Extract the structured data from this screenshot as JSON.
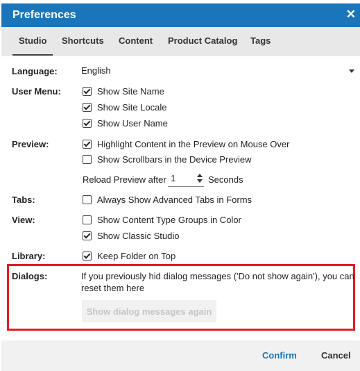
{
  "dialog": {
    "title": "Preferences",
    "close_glyph": "✕"
  },
  "tabs": [
    {
      "label": "Studio",
      "active": true
    },
    {
      "label": "Shortcuts"
    },
    {
      "label": "Content"
    },
    {
      "label": "Product Catalog"
    },
    {
      "label": "Tags"
    }
  ],
  "language": {
    "label": "Language:",
    "value": "English"
  },
  "user_menu": {
    "label": "User Menu:",
    "options": [
      {
        "label": "Show Site Name",
        "checked": true
      },
      {
        "label": "Show Site Locale",
        "checked": true
      },
      {
        "label": "Show User Name",
        "checked": true
      }
    ]
  },
  "preview": {
    "label": "Preview:",
    "options": [
      {
        "label": "Highlight Content in the Preview on Mouse Over",
        "checked": true
      },
      {
        "label": "Show Scrollbars in the Device Preview",
        "checked": false
      }
    ],
    "reload_prefix": "Reload Preview after",
    "reload_value": "1",
    "reload_suffix": "Seconds"
  },
  "tabs_pref": {
    "label": "Tabs:",
    "options": [
      {
        "label": "Always Show Advanced Tabs in Forms",
        "checked": false
      }
    ]
  },
  "view": {
    "label": "View:",
    "options": [
      {
        "label": "Show Content Type Groups in Color",
        "checked": false
      },
      {
        "label": "Show Classic Studio",
        "checked": true
      }
    ]
  },
  "library": {
    "label": "Library:",
    "options": [
      {
        "label": "Keep Folder on Top",
        "checked": true
      }
    ]
  },
  "dialogs": {
    "label": "Dialogs:",
    "text": "If you previously hid dialog messages ('Do not show again'), you can reset them here",
    "button": "Show dialog messages again",
    "highlight_color": "#e31b23"
  },
  "footer": {
    "confirm": "Confirm",
    "cancel": "Cancel"
  },
  "colors": {
    "accent": "#1b75bb",
    "tabbar": "#e8e8e8",
    "footer": "#f1f1f1"
  }
}
